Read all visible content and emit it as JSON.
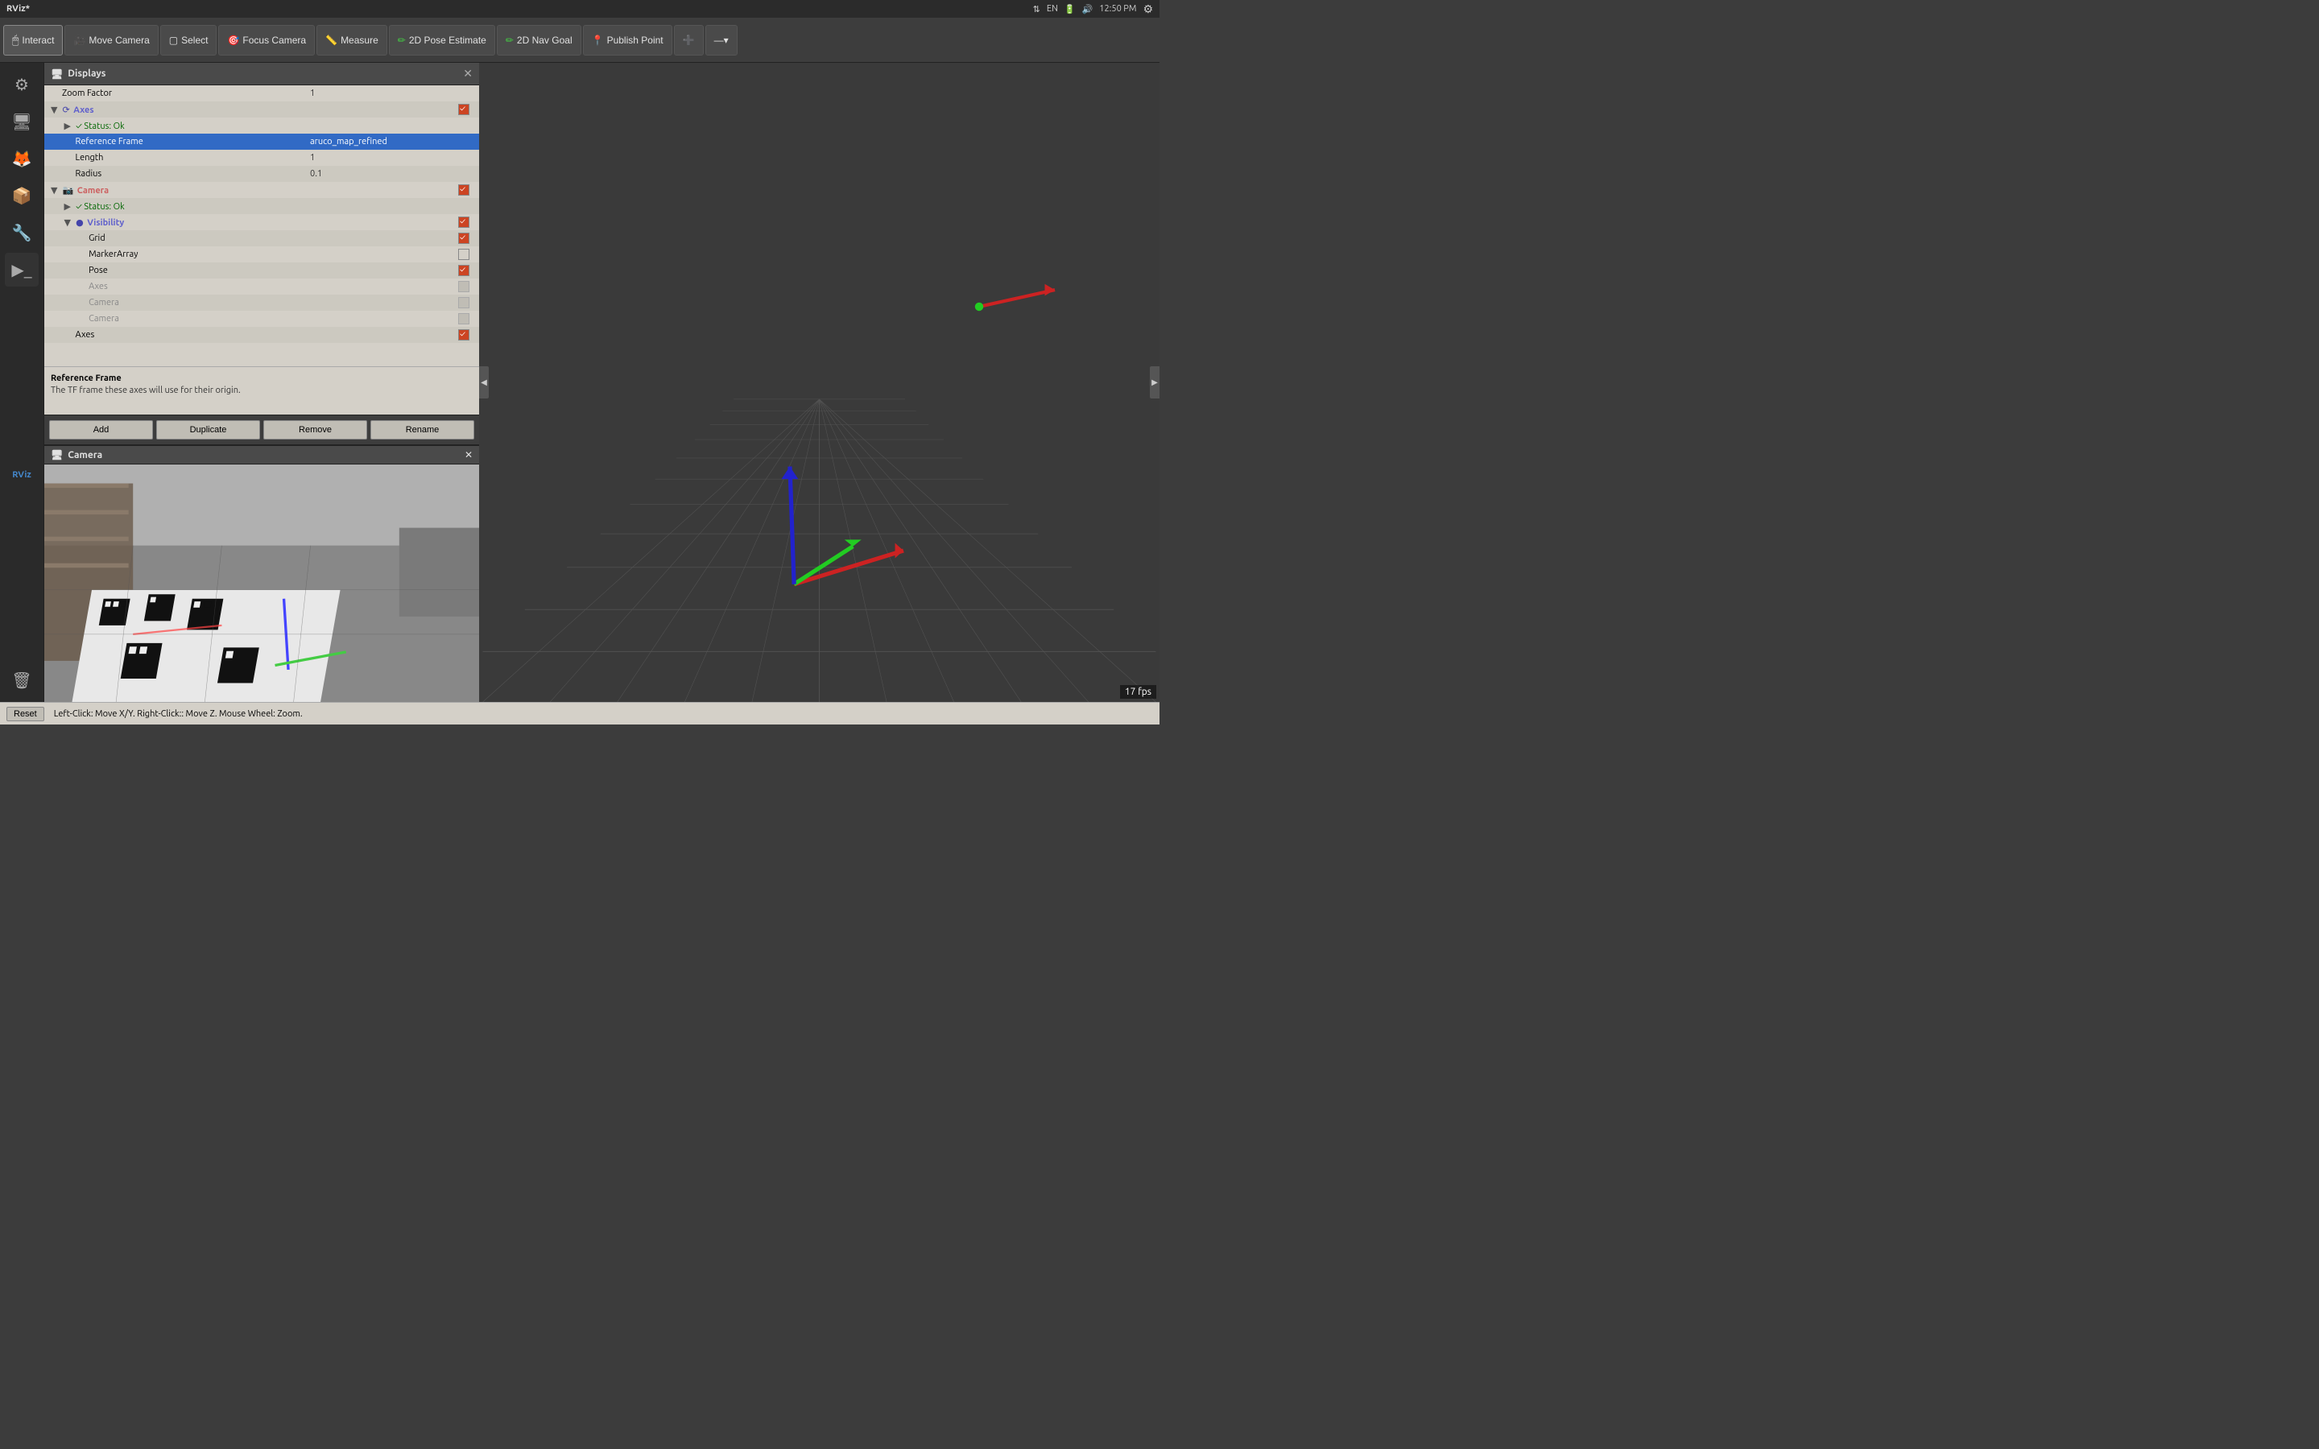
{
  "titlebar": {
    "title": "RViz*",
    "time": "12:50 PM",
    "icons": [
      "network",
      "keyboard",
      "battery",
      "volume"
    ]
  },
  "toolbar": {
    "interact_label": "Interact",
    "move_camera_label": "Move Camera",
    "select_label": "Select",
    "focus_camera_label": "Focus Camera",
    "measure_label": "Measure",
    "pose_estimate_label": "2D Pose Estimate",
    "nav_goal_label": "2D Nav Goal",
    "publish_point_label": "Publish Point"
  },
  "displays": {
    "title": "Displays",
    "items": [
      {
        "indent": 0,
        "name": "Zoom Factor",
        "value": "1",
        "has_checkbox": false,
        "checked": false,
        "type": "property"
      },
      {
        "indent": 0,
        "name": "Axes",
        "value": "",
        "has_checkbox": true,
        "checked": true,
        "type": "header-axes",
        "expanded": true
      },
      {
        "indent": 1,
        "name": "Status: Ok",
        "value": "",
        "has_checkbox": false,
        "checked": false,
        "type": "status"
      },
      {
        "indent": 1,
        "name": "Reference Frame",
        "value": "aruco_map_refined",
        "has_checkbox": false,
        "checked": false,
        "type": "property",
        "selected": true
      },
      {
        "indent": 1,
        "name": "Length",
        "value": "1",
        "has_checkbox": false,
        "checked": false,
        "type": "property"
      },
      {
        "indent": 1,
        "name": "Radius",
        "value": "0.1",
        "has_checkbox": false,
        "checked": false,
        "type": "property"
      },
      {
        "indent": 0,
        "name": "Camera",
        "value": "",
        "has_checkbox": true,
        "checked": true,
        "type": "header-camera",
        "expanded": true
      },
      {
        "indent": 1,
        "name": "Status: Ok",
        "value": "",
        "has_checkbox": false,
        "checked": false,
        "type": "status"
      },
      {
        "indent": 1,
        "name": "Visibility",
        "value": "",
        "has_checkbox": true,
        "checked": true,
        "type": "header-visibility",
        "expanded": true
      },
      {
        "indent": 2,
        "name": "Grid",
        "value": "",
        "has_checkbox": true,
        "checked": true,
        "type": "property"
      },
      {
        "indent": 2,
        "name": "MarkerArray",
        "value": "",
        "has_checkbox": true,
        "checked": false,
        "type": "property"
      },
      {
        "indent": 2,
        "name": "Pose",
        "value": "",
        "has_checkbox": true,
        "checked": true,
        "type": "property"
      },
      {
        "indent": 2,
        "name": "Axes",
        "value": "",
        "has_checkbox": true,
        "checked": false,
        "disabled": true,
        "type": "property"
      },
      {
        "indent": 2,
        "name": "Camera",
        "value": "",
        "has_checkbox": true,
        "checked": false,
        "disabled": true,
        "type": "property"
      },
      {
        "indent": 2,
        "name": "Camera",
        "value": "",
        "has_checkbox": true,
        "checked": false,
        "disabled": true,
        "type": "property"
      },
      {
        "indent": 1,
        "name": "Axes",
        "value": "",
        "has_checkbox": true,
        "checked": true,
        "type": "property"
      },
      {
        "indent": 1,
        "name": "...",
        "value": "...",
        "has_checkbox": false,
        "checked": false,
        "type": "property"
      }
    ],
    "info_title": "Reference Frame",
    "info_desc": "The TF frame these axes will use for their origin.",
    "buttons": [
      "Add",
      "Duplicate",
      "Remove",
      "Rename"
    ]
  },
  "camera": {
    "title": "Camera"
  },
  "statusbar": {
    "reset_label": "Reset",
    "status_text": "Left-Click: Move X/Y.  Right-Click:: Move Z.  Mouse Wheel: Zoom."
  },
  "viewport": {
    "fps": "17 fps"
  }
}
